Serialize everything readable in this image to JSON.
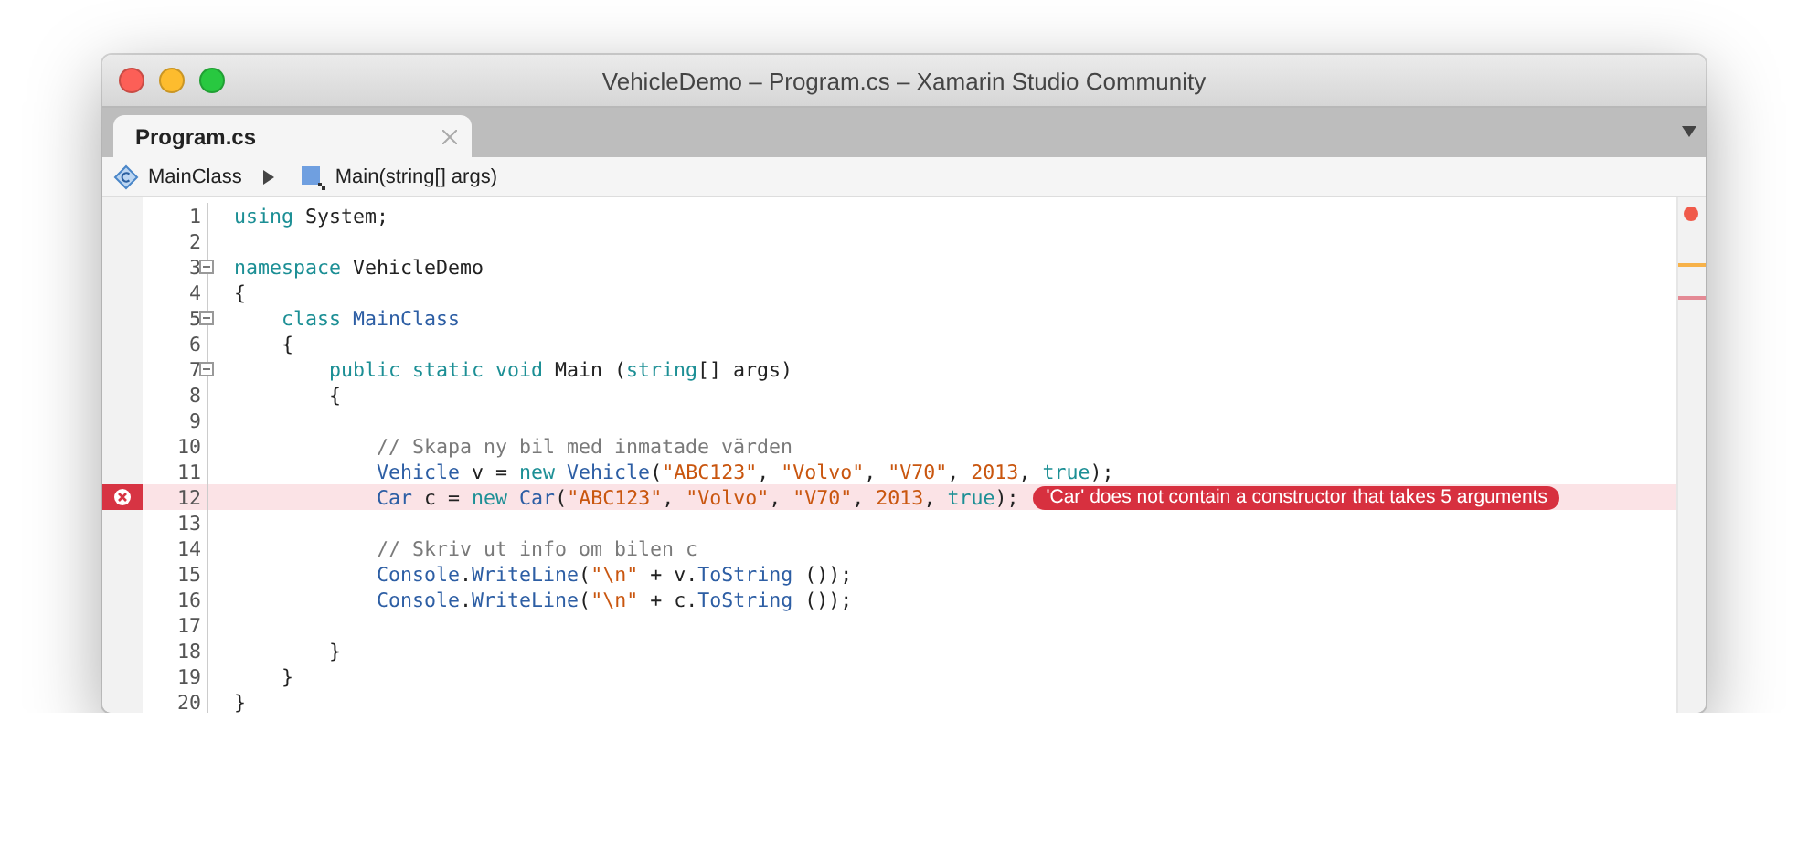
{
  "window": {
    "title": "VehicleDemo – Program.cs – Xamarin Studio Community"
  },
  "tabs": [
    {
      "label": "Program.cs",
      "selected": true
    }
  ],
  "breadcrumb": [
    {
      "kind": "class",
      "label": "MainClass"
    },
    {
      "kind": "method",
      "label": "Main(string[] args)"
    }
  ],
  "lines": [
    {
      "number": "1",
      "fold": false,
      "error": false,
      "tokens": [
        {
          "kind": "keyword",
          "text": "using"
        },
        {
          "kind": "plain",
          "text": " System;"
        }
      ]
    },
    {
      "number": "2",
      "fold": false,
      "error": false
    },
    {
      "number": "3",
      "fold": true,
      "error": false,
      "tokens": [
        {
          "kind": "keyword",
          "text": "namespace"
        },
        {
          "kind": "plain",
          "text": " VehicleDemo"
        }
      ]
    },
    {
      "number": "4",
      "fold": false,
      "error": false,
      "tokens": [
        {
          "kind": "plain",
          "text": "{"
        }
      ]
    },
    {
      "number": "5",
      "fold": true,
      "error": false,
      "tokens": [
        {
          "kind": "keyword",
          "text": "    class"
        },
        {
          "kind": "type",
          "text": " MainClass"
        }
      ]
    },
    {
      "number": "6",
      "fold": false,
      "error": false,
      "tokens": [
        {
          "kind": "plain",
          "text": "    {"
        }
      ]
    },
    {
      "number": "7",
      "fold": true,
      "error": false,
      "tokens": [
        {
          "kind": "keyword",
          "text": "        public static void"
        },
        {
          "kind": "plain",
          "text": " Main ("
        },
        {
          "kind": "keyword",
          "text": "string"
        },
        {
          "kind": "plain",
          "text": "[] args)"
        }
      ]
    },
    {
      "number": "8",
      "fold": false,
      "error": false,
      "tokens": [
        {
          "kind": "plain",
          "text": "        {"
        }
      ]
    },
    {
      "number": "9",
      "fold": false,
      "error": false
    },
    {
      "number": "10",
      "fold": false,
      "error": false,
      "tokens": [
        {
          "kind": "comment",
          "text": "            // Skapa ny bil med inmatade värden"
        }
      ]
    },
    {
      "number": "11",
      "fold": false,
      "error": false,
      "tokens": [
        {
          "kind": "type",
          "text": "            Vehicle"
        },
        {
          "kind": "plain",
          "text": " v = "
        },
        {
          "kind": "keyword",
          "text": "new"
        },
        {
          "kind": "type",
          "text": " Vehicle"
        },
        {
          "kind": "plain",
          "text": "("
        },
        {
          "kind": "string",
          "text": "\"ABC123\""
        },
        {
          "kind": "plain",
          "text": ", "
        },
        {
          "kind": "string",
          "text": "\"Volvo\""
        },
        {
          "kind": "plain",
          "text": ", "
        },
        {
          "kind": "string",
          "text": "\"V70\""
        },
        {
          "kind": "plain",
          "text": ", "
        },
        {
          "kind": "number",
          "text": "2013"
        },
        {
          "kind": "plain",
          "text": ", "
        },
        {
          "kind": "keyword",
          "text": "true"
        },
        {
          "kind": "plain",
          "text": ");"
        }
      ]
    },
    {
      "number": "12",
      "fold": false,
      "error": true,
      "message": "'Car' does not contain a constructor that takes 5 arguments",
      "tokens": [
        {
          "kind": "type",
          "text": "            Car"
        },
        {
          "kind": "plain",
          "text": " c = "
        },
        {
          "kind": "keyword",
          "text": "new"
        },
        {
          "kind": "type",
          "text": " Car"
        },
        {
          "kind": "plain",
          "text": "("
        },
        {
          "kind": "string",
          "text": "\"ABC123\""
        },
        {
          "kind": "plain",
          "text": ", "
        },
        {
          "kind": "string",
          "text": "\"Volvo\""
        },
        {
          "kind": "plain",
          "text": ", "
        },
        {
          "kind": "string",
          "text": "\"V70\""
        },
        {
          "kind": "plain",
          "text": ", "
        },
        {
          "kind": "number",
          "text": "2013"
        },
        {
          "kind": "plain",
          "text": ", "
        },
        {
          "kind": "keyword",
          "text": "true"
        },
        {
          "kind": "plain",
          "text": ");"
        }
      ]
    },
    {
      "number": "13",
      "fold": false,
      "error": false
    },
    {
      "number": "14",
      "fold": false,
      "error": false,
      "tokens": [
        {
          "kind": "comment",
          "text": "            // Skriv ut info om bilen c"
        }
      ]
    },
    {
      "number": "15",
      "fold": false,
      "error": false,
      "tokens": [
        {
          "kind": "type",
          "text": "            Console"
        },
        {
          "kind": "plain",
          "text": "."
        },
        {
          "kind": "type",
          "text": "WriteLine"
        },
        {
          "kind": "plain",
          "text": "("
        },
        {
          "kind": "string",
          "text": "\"\\n\""
        },
        {
          "kind": "plain",
          "text": " + v."
        },
        {
          "kind": "type",
          "text": "ToString"
        },
        {
          "kind": "plain",
          "text": " ());"
        }
      ]
    },
    {
      "number": "16",
      "fold": false,
      "error": false,
      "tokens": [
        {
          "kind": "type",
          "text": "            Console"
        },
        {
          "kind": "plain",
          "text": "."
        },
        {
          "kind": "type",
          "text": "WriteLine"
        },
        {
          "kind": "plain",
          "text": "("
        },
        {
          "kind": "string",
          "text": "\"\\n\""
        },
        {
          "kind": "plain",
          "text": " + c."
        },
        {
          "kind": "type",
          "text": "ToString"
        },
        {
          "kind": "plain",
          "text": " ());"
        }
      ]
    },
    {
      "number": "17",
      "fold": false,
      "error": false
    },
    {
      "number": "18",
      "fold": false,
      "error": false,
      "tokens": [
        {
          "kind": "plain",
          "text": "        }"
        }
      ]
    },
    {
      "number": "19",
      "fold": false,
      "error": false,
      "tokens": [
        {
          "kind": "plain",
          "text": "    }"
        }
      ]
    },
    {
      "number": "20",
      "fold": false,
      "error": false,
      "tokens": [
        {
          "kind": "plain",
          "text": "}"
        }
      ]
    }
  ]
}
